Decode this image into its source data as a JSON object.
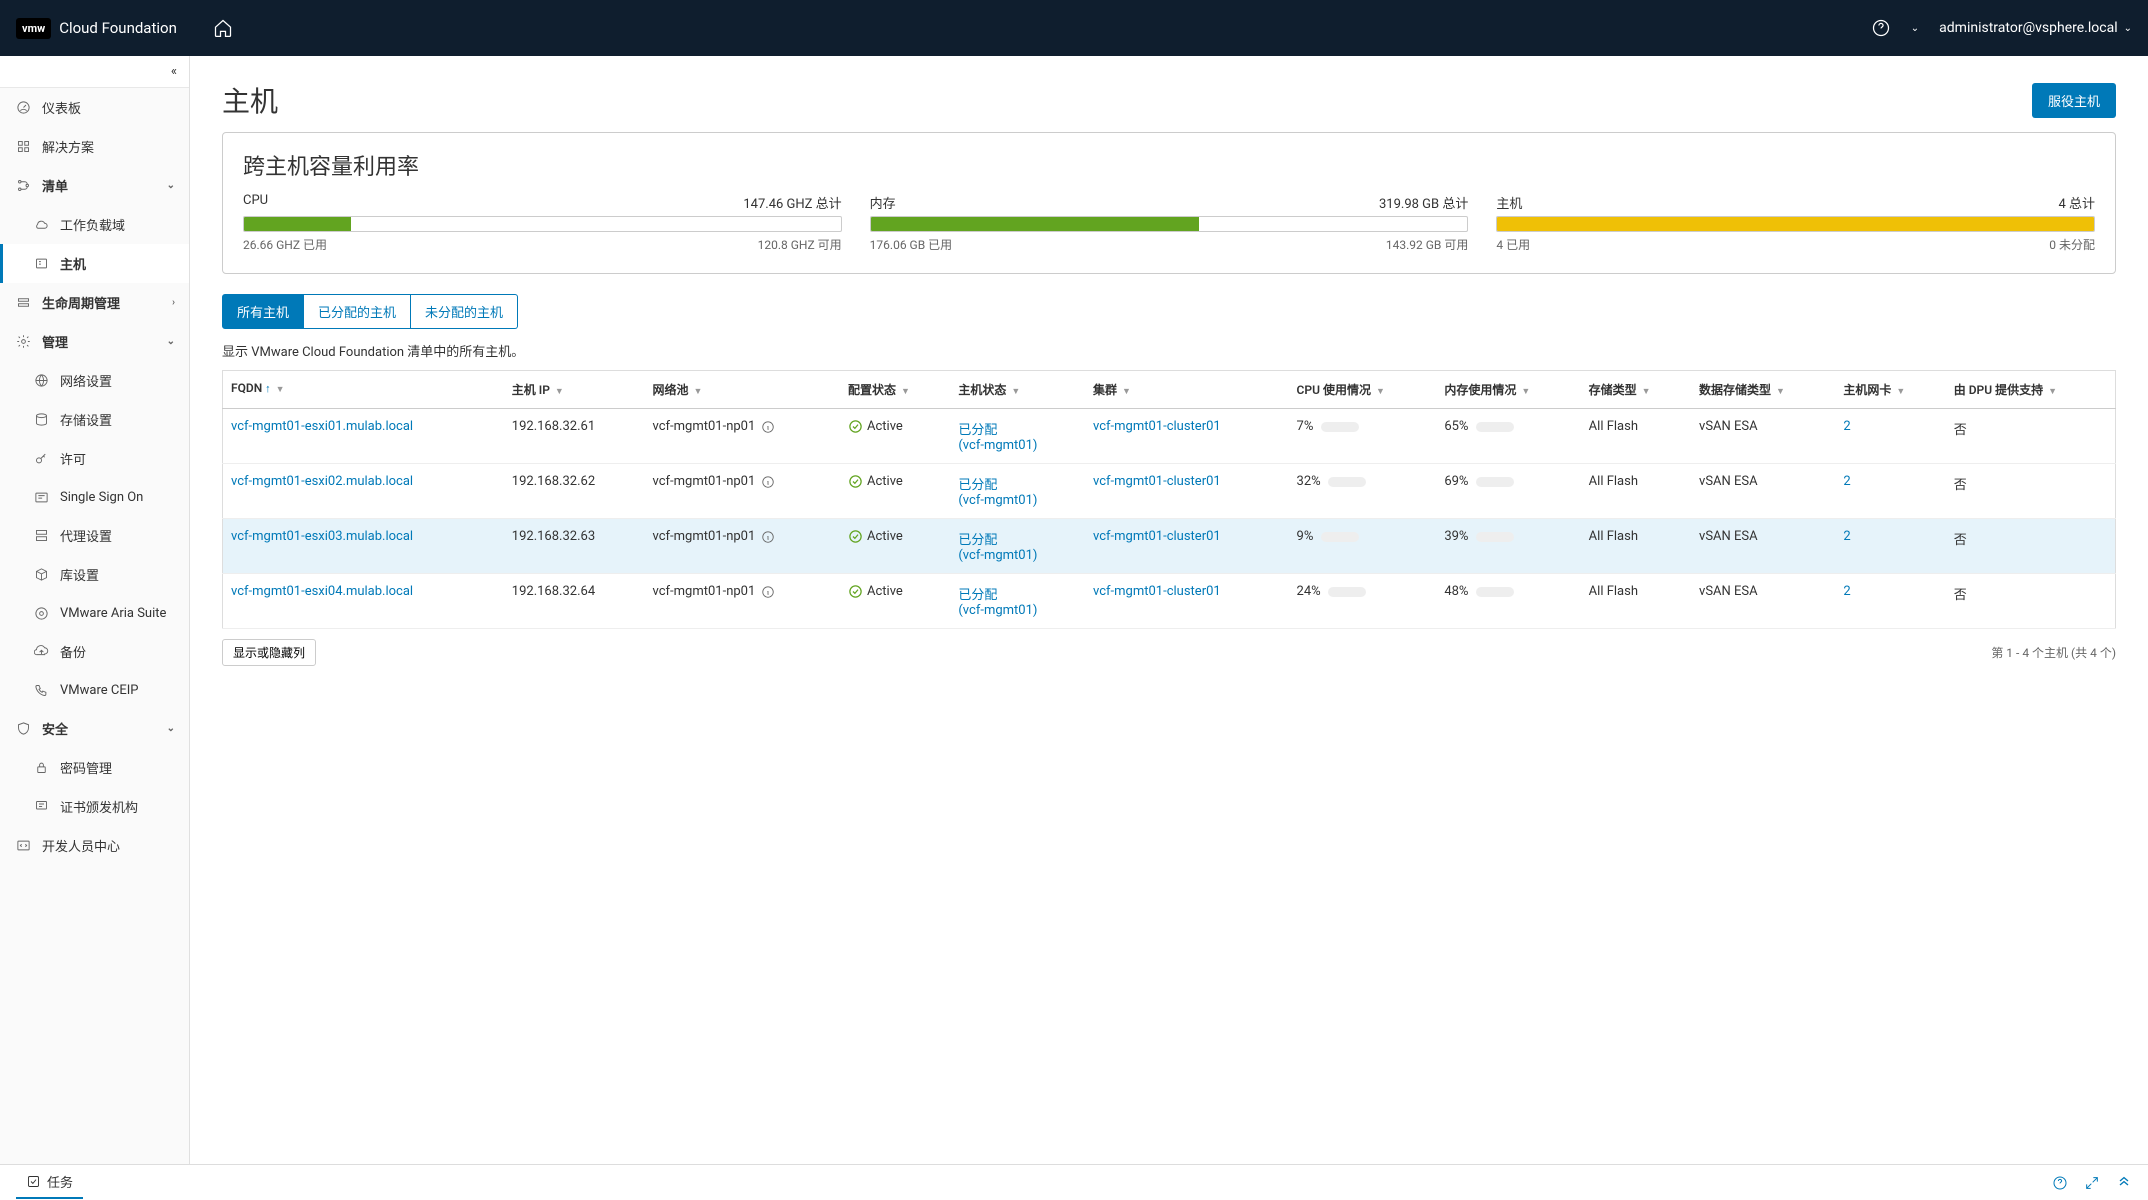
{
  "header": {
    "logo": "vmw",
    "brand": "Cloud Foundation",
    "user": "administrator@vsphere.local"
  },
  "sidebar": {
    "dashboard": "仪表板",
    "solutions": "解决方案",
    "inventory": "清单",
    "workload_domains": "工作负载域",
    "hosts": "主机",
    "lifecycle": "生命周期管理",
    "administration": "管理",
    "network": "网络设置",
    "storage": "存储设置",
    "licensing": "许可",
    "sso": "Single Sign On",
    "proxy": "代理设置",
    "repository": "库设置",
    "aria": "VMware Aria Suite",
    "backup": "备份",
    "ceip": "VMware CEIP",
    "security": "安全",
    "password": "密码管理",
    "certificate": "证书颁发机构",
    "dev_center": "开发人员中心"
  },
  "page": {
    "title": "主机",
    "button": "服役主机"
  },
  "capacity": {
    "title": "跨主机容量利用率",
    "cpu": {
      "label": "CPU",
      "total": "147.46 GHZ 总计",
      "used": "26.66 GHZ 已用",
      "free": "120.8 GHZ 可用",
      "pct": 18
    },
    "memory": {
      "label": "内存",
      "total": "319.98 GB 总计",
      "used": "176.06 GB 已用",
      "free": "143.92 GB 可用",
      "pct": 55
    },
    "hosts": {
      "label": "主机",
      "total": "4 总计",
      "used": "4 已用",
      "free": "0 未分配",
      "pct": 100
    }
  },
  "tabs": {
    "all": "所有主机",
    "assigned": "已分配的主机",
    "unassigned": "未分配的主机",
    "desc": "显示 VMware Cloud Foundation 清单中的所有主机。"
  },
  "columns": {
    "fqdn": "FQDN",
    "ip": "主机 IP",
    "pool": "网络池",
    "config": "配置状态",
    "host_state": "主机状态",
    "cluster": "集群",
    "cpu": "CPU 使用情况",
    "memory": "内存使用情况",
    "storage": "存储类型",
    "datastorage": "数据存储类型",
    "nic": "主机网卡",
    "dpu": "由 DPU 提供支持"
  },
  "rows": [
    {
      "fqdn": "vcf-mgmt01-esxi01.mulab.local",
      "ip": "192.168.32.61",
      "pool": "vcf-mgmt01-np01",
      "config": "Active",
      "state_l1": "已分配",
      "state_l2": "(vcf-mgmt01)",
      "cluster": "vcf-mgmt01-cluster01",
      "cpu": "7%",
      "cpu_pct": 7,
      "mem": "65%",
      "mem_pct": 65,
      "storage": "All Flash",
      "ds": "vSAN ESA",
      "nic": "2",
      "dpu": "否"
    },
    {
      "fqdn": "vcf-mgmt01-esxi02.mulab.local",
      "ip": "192.168.32.62",
      "pool": "vcf-mgmt01-np01",
      "config": "Active",
      "state_l1": "已分配",
      "state_l2": "(vcf-mgmt01)",
      "cluster": "vcf-mgmt01-cluster01",
      "cpu": "32%",
      "cpu_pct": 32,
      "mem": "69%",
      "mem_pct": 69,
      "storage": "All Flash",
      "ds": "vSAN ESA",
      "nic": "2",
      "dpu": "否"
    },
    {
      "fqdn": "vcf-mgmt01-esxi03.mulab.local",
      "ip": "192.168.32.63",
      "pool": "vcf-mgmt01-np01",
      "config": "Active",
      "state_l1": "已分配",
      "state_l2": "(vcf-mgmt01)",
      "cluster": "vcf-mgmt01-cluster01",
      "cpu": "9%",
      "cpu_pct": 9,
      "mem": "39%",
      "mem_pct": 39,
      "storage": "All Flash",
      "ds": "vSAN ESA",
      "nic": "2",
      "dpu": "否",
      "highlight": true
    },
    {
      "fqdn": "vcf-mgmt01-esxi04.mulab.local",
      "ip": "192.168.32.64",
      "pool": "vcf-mgmt01-np01",
      "config": "Active",
      "state_l1": "已分配",
      "state_l2": "(vcf-mgmt01)",
      "cluster": "vcf-mgmt01-cluster01",
      "cpu": "24%",
      "cpu_pct": 24,
      "mem": "48%",
      "mem_pct": 48,
      "storage": "All Flash",
      "ds": "vSAN ESA",
      "nic": "2",
      "dpu": "否"
    }
  ],
  "table_footer": {
    "columns_btn": "显示或隐藏列",
    "pagination": "第 1 - 4 个主机 (共 4 个)"
  },
  "bottom": {
    "tasks": "任务"
  }
}
